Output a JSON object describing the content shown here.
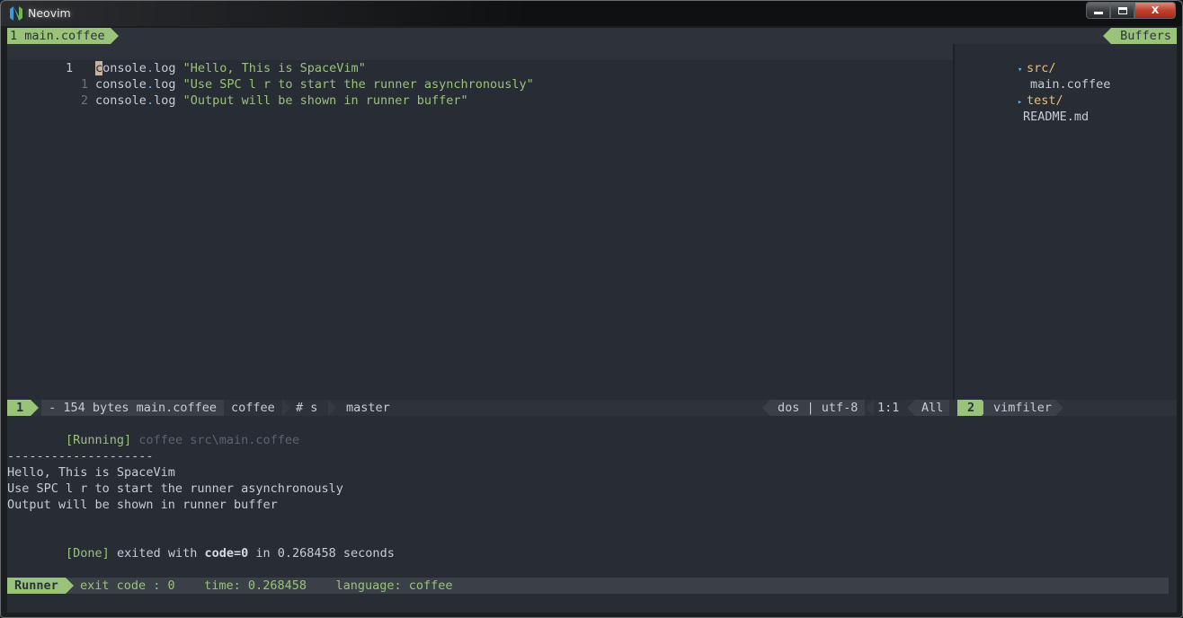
{
  "window": {
    "title": "Neovim",
    "buttons": {
      "minimize": "—",
      "maximize": "▫",
      "close": "X"
    }
  },
  "tabline": {
    "active_tab": "1 main.coffee",
    "right_label": "Buffers"
  },
  "editor": {
    "lines": [
      {
        "number": "1",
        "relative": false,
        "cursor_char": "c",
        "code_rest": "onsole",
        "dot": ".",
        "fn": "log",
        "string": "\"Hello, This is SpaceVim\""
      },
      {
        "number": "1",
        "relative": true,
        "code": "console",
        "dot": ".",
        "fn": "log",
        "string": "\"Use SPC l r to start the runner asynchronously\""
      },
      {
        "number": "2",
        "relative": true,
        "code": "console",
        "dot": ".",
        "fn": "log",
        "string": "\"Output will be shown in runner buffer\""
      }
    ]
  },
  "filetree": {
    "items": [
      {
        "type": "dir",
        "expanded": true,
        "icon": "▾",
        "name": "src/"
      },
      {
        "type": "file",
        "name": "main.coffee"
      },
      {
        "type": "dir",
        "expanded": false,
        "icon": "▸",
        "name": "test/"
      },
      {
        "type": "file",
        "name": "README.md"
      }
    ]
  },
  "statusline": {
    "window_number": "1",
    "file_info": " - 154 bytes main.coffee ",
    "filetype": "coffee",
    "syntax": "# s",
    "branch": "master",
    "fileformat": "dos | utf-8",
    "position": "1:1",
    "scroll": "All",
    "right_window_number": "2",
    "right_filetype": "vimfiler"
  },
  "runner": {
    "running_tag": "[Running]",
    "command": " coffee src\\main.coffee",
    "separator": "--------------------",
    "output": [
      "Hello, This is SpaceVim",
      "Use SPC l r to start the runner asynchronously",
      "Output will be shown in runner buffer"
    ],
    "done_tag": "[Done]",
    "done_prefix": " exited with ",
    "done_code": "code=0",
    "done_suffix": " in 0.268458 seconds"
  },
  "runner_status": {
    "label": "Runner",
    "info": "exit code : 0    time: 0.268458    language: coffee"
  },
  "colors": {
    "accent": "#98c379",
    "background": "#282c34",
    "directory": "#e5c07b",
    "tree_arrow": "#61afef"
  }
}
